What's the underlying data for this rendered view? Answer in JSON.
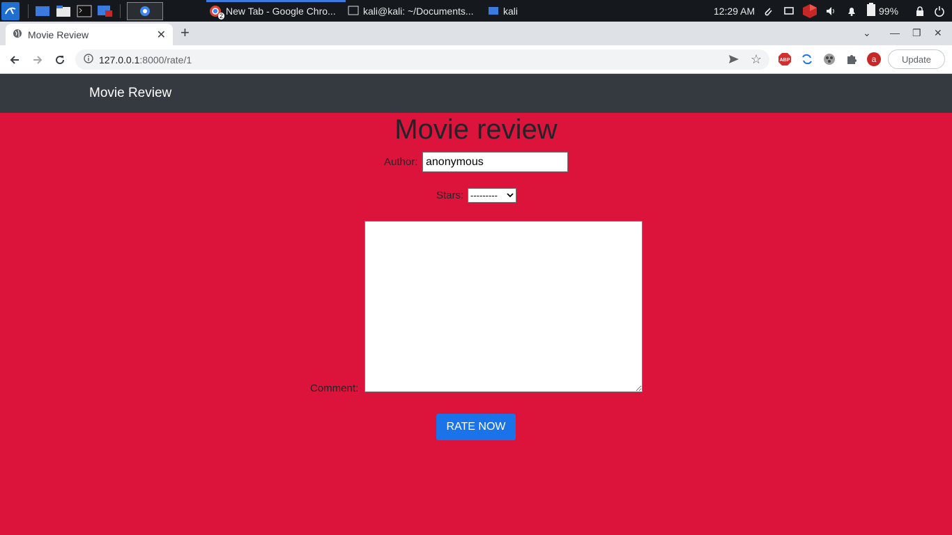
{
  "taskbar": {
    "windows": [
      {
        "title": "New Tab - Google Chro...",
        "badge": "2"
      },
      {
        "title": "kali@kali: ~/Documents..."
      },
      {
        "title": "kali"
      }
    ],
    "clock": "12:29 AM",
    "battery": "99%"
  },
  "browser": {
    "tab_title": "Movie Review",
    "url_host": "127.0.0.1",
    "url_rest": ":8000/rate/1",
    "update_label": "Update",
    "extensions": [
      "ABP",
      "sync-icon",
      "extension-icon",
      "puzzle-icon",
      "a"
    ]
  },
  "page": {
    "brand": "Movie Review",
    "title": "Movie review",
    "form": {
      "author_label": "Author:",
      "author_value": "anonymous",
      "stars_label": "Stars:",
      "stars_selected": "---------",
      "comment_label": "Comment:",
      "comment_value": "",
      "submit_label": "RATE NOW"
    }
  },
  "colors": {
    "page_bg": "#dc143c",
    "navbar_bg": "#343a40",
    "button_bg": "#1a73e8",
    "taskbar_bg": "#15181c"
  }
}
